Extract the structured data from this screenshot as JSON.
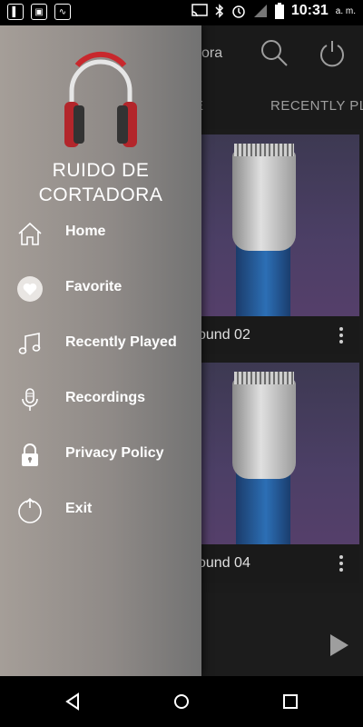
{
  "status_bar": {
    "time": "10:31",
    "ampm": "a. m.",
    "icons": [
      "notification-icon",
      "cast-icon",
      "bluetooth-icon",
      "alarm-icon",
      "signal-icon",
      "battery-icon"
    ]
  },
  "app": {
    "title_partial": "ora",
    "tabs": [
      "E",
      "RECENTLY PL"
    ],
    "cards": [
      {
        "label": "ound 02"
      },
      {
        "label": "ound 04"
      }
    ]
  },
  "drawer": {
    "title": "RUIDO DE CORTADORA",
    "menu": [
      {
        "label": "Home",
        "icon": "home-icon"
      },
      {
        "label": "Favorite",
        "icon": "heart-icon"
      },
      {
        "label": "Recently Played",
        "icon": "music-note-icon"
      },
      {
        "label": "Recordings",
        "icon": "microphone-icon"
      },
      {
        "label": "Privacy Policy",
        "icon": "lock-icon"
      },
      {
        "label": "Exit",
        "icon": "power-icon"
      }
    ]
  },
  "colors": {
    "drawer_gradient_start": "#a59e98",
    "drawer_gradient_end": "#727272",
    "headphone_accent": "#c8282d",
    "app_background": "#1b1b1b"
  }
}
